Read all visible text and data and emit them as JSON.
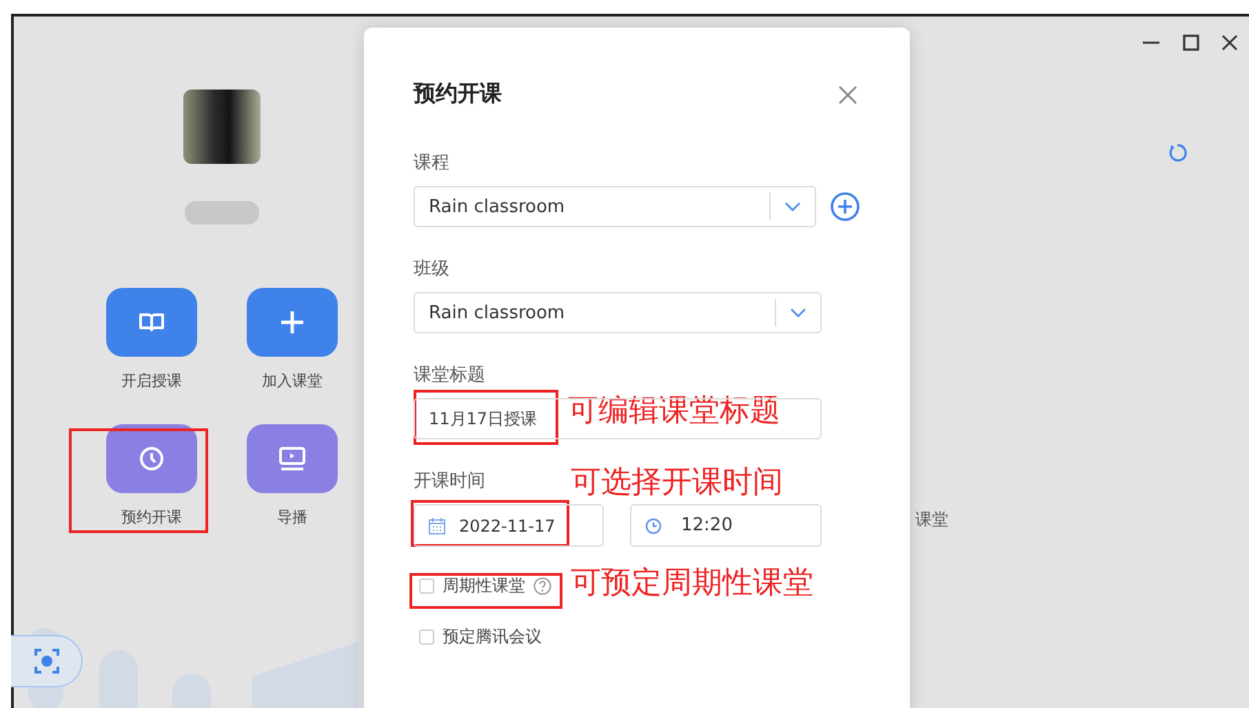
{
  "launcher": {
    "tiles": [
      {
        "label": "开启授课",
        "kind": "book",
        "color": "#3f82ea"
      },
      {
        "label": "加入课堂",
        "kind": "plus",
        "color": "#3f82ea"
      },
      {
        "label": "预约开课",
        "kind": "clock",
        "color": "#8a7fe3"
      },
      {
        "label": "导播",
        "kind": "monitor",
        "color": "#8a7fe3"
      }
    ]
  },
  "background_text": "课堂",
  "dialog": {
    "title": "预约开课",
    "course": {
      "label": "课程",
      "value": "Rain classroom"
    },
    "class": {
      "label": "班级",
      "value": "Rain classroom"
    },
    "lesson_title": {
      "label": "课堂标题",
      "value": "11月17日授课"
    },
    "start_time": {
      "label": "开课时间",
      "date": "2022-11-17",
      "time": "12:20"
    },
    "options": [
      {
        "label": "周期性课堂",
        "checked": false,
        "help": true
      },
      {
        "label": "预定腾讯会议",
        "checked": false,
        "help": false
      }
    ]
  },
  "annotations": [
    {
      "text": "可编辑课堂标题"
    },
    {
      "text": "可选择开课时间"
    },
    {
      "text": "可预定周期性课堂"
    }
  ]
}
